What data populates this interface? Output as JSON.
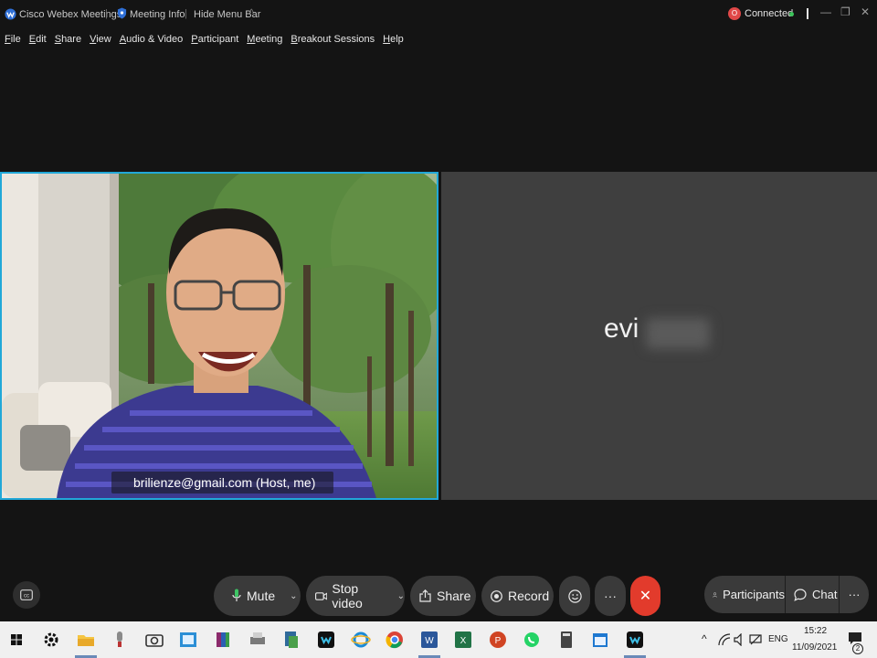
{
  "titlebar": {
    "app_name": "Cisco Webex Meetings",
    "separator": "|",
    "meeting_info": "Meeting Info",
    "hide_menu_bar": "Hide Menu Bar",
    "caret": "^",
    "recording_icon_letter": "O",
    "status": "Connected",
    "minimize": "—",
    "restore": "❐",
    "close": "✕"
  },
  "menubar": {
    "items": [
      {
        "u": "F",
        "rest": "ile"
      },
      {
        "u": "E",
        "rest": "dit"
      },
      {
        "u": "S",
        "rest": "hare"
      },
      {
        "u": "V",
        "rest": "iew"
      },
      {
        "u": "A",
        "rest": "udio & Video"
      },
      {
        "u": "P",
        "rest": "articipant"
      },
      {
        "u": "M",
        "rest": "eeting"
      },
      {
        "u": "B",
        "rest": "reakout Sessions"
      },
      {
        "u": "H",
        "rest": "elp"
      }
    ]
  },
  "video": {
    "self_label": "brilienze@gmail.com (Host, me)",
    "remote_name": "evi"
  },
  "controls": {
    "mute": "Mute",
    "stop_video": "Stop video",
    "share": "Share",
    "record": "Record",
    "more": "···",
    "participants": "Participants",
    "chat": "Chat",
    "right_more": "···"
  },
  "taskbar": {
    "language": "ENG",
    "time": "15:22",
    "date": "11/09/2021",
    "notification_count": "2"
  },
  "colors": {
    "active_speaker_border": "#21a8d8",
    "leave_button": "#e23b2c",
    "connected_dot": "#3cc45a",
    "recording_badge": "#e04848"
  }
}
